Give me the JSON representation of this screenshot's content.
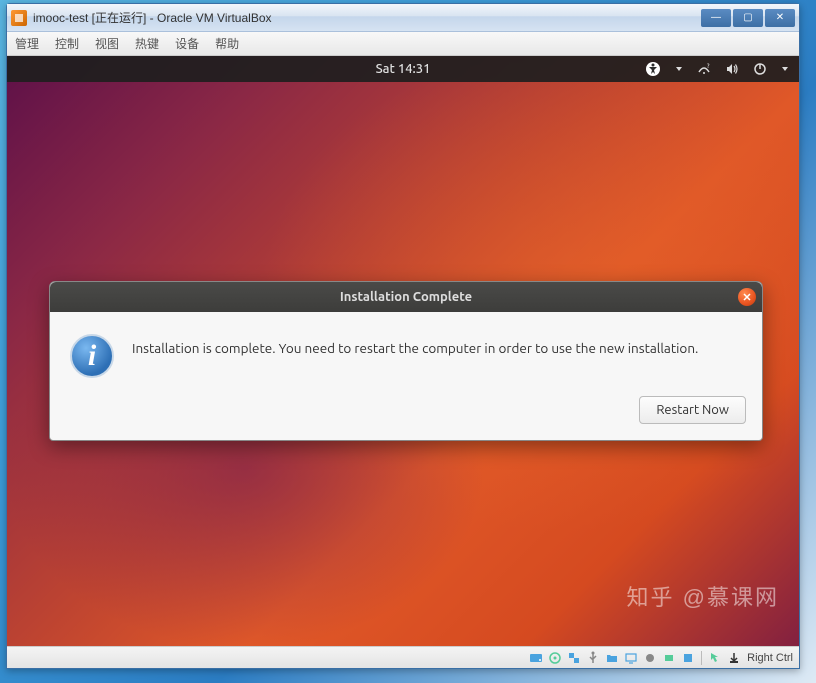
{
  "window": {
    "title": "imooc-test [正在运行] - Oracle VM VirtualBox"
  },
  "menubar": {
    "items": [
      "管理",
      "控制",
      "视图",
      "热键",
      "设备",
      "帮助"
    ]
  },
  "ubuntu_topbar": {
    "clock": "Sat 14:31"
  },
  "dialog": {
    "title": "Installation Complete",
    "message": "Installation is complete. You need to restart the computer in order to use the new installation.",
    "button": "Restart Now"
  },
  "statusbar": {
    "host_key": "Right Ctrl"
  },
  "watermark": "知乎 @慕课网"
}
